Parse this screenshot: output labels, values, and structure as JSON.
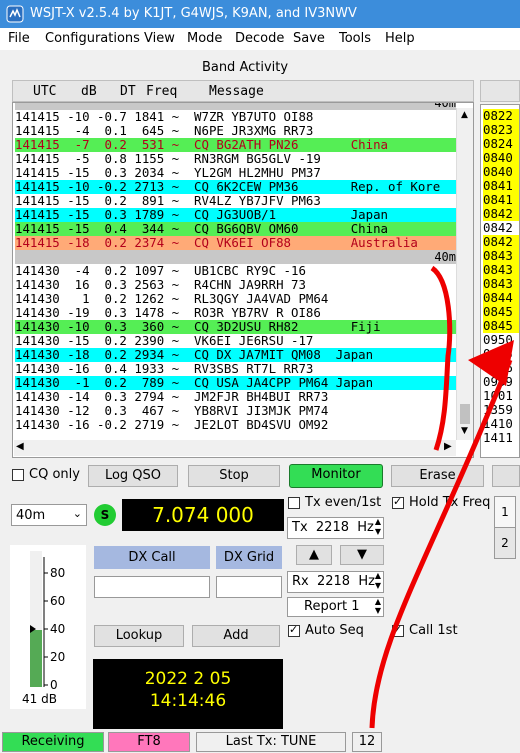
{
  "window": {
    "title": "WSJT-X   v2.5.4   by K1JT, G4WJS, K9AN, and IV3NWV"
  },
  "menu": [
    "File",
    "Configurations",
    "View",
    "Mode",
    "Decode",
    "Save",
    "Tools",
    "Help"
  ],
  "band_activity": {
    "title": "Band Activity",
    "columns": [
      "UTC",
      "dB",
      "DT",
      "Freq",
      "Message"
    ],
    "band_marker_top": "40m",
    "rows": [
      {
        "text": "141415 -10 -0.7 1841 ~  W7ZR YB7UTO OI88",
        "bg": "#ffffff",
        "fg": "#000000"
      },
      {
        "text": "141415  -4  0.1  645 ~  N6PE JR3XMG RR73",
        "bg": "#ffffff",
        "fg": "#000000"
      },
      {
        "text": "141415  -7  0.2  531 ~  CQ BG2ATH PN26       China",
        "bg": "#55ee55",
        "fg": "#b3001b"
      },
      {
        "text": "141415  -5  0.8 1155 ~  RN3RGM BG5GLV -19",
        "bg": "#ffffff",
        "fg": "#000000"
      },
      {
        "text": "141415 -15  0.3 2034 ~  YL2GM HL2MHU PM37",
        "bg": "#ffffff",
        "fg": "#000000"
      },
      {
        "text": "141415 -10 -0.2 2713 ~  CQ 6K2CEW PM36       Rep. of Kore",
        "bg": "#00ffff",
        "fg": "#000000"
      },
      {
        "text": "141415 -15  0.2  891 ~  RV4LZ YB7JFV PM63",
        "bg": "#ffffff",
        "fg": "#000000"
      },
      {
        "text": "141415 -15  0.3 1789 ~  CQ JG3UOB/1          Japan",
        "bg": "#00ffff",
        "fg": "#000000"
      },
      {
        "text": "141415 -15  0.4  344 ~  CQ BG6QBV OM60       China",
        "bg": "#55ee55",
        "fg": "#000000"
      },
      {
        "text": "141415 -18  0.2 2374 ~  CQ VK6EI OF88        Australia",
        "bg": "#ffaa77",
        "fg": "#b3001b"
      },
      {
        "sep": "40m"
      },
      {
        "text": "141430  -4  0.2 1097 ~  UB1CBC RY9C -16",
        "bg": "#ffffff",
        "fg": "#000000"
      },
      {
        "text": "141430  16  0.3 2563 ~  R4CHN JA9RRH 73",
        "bg": "#ffffff",
        "fg": "#000000"
      },
      {
        "text": "141430   1  0.2 1262 ~  RL3QGY JA4VAD PM64",
        "bg": "#ffffff",
        "fg": "#000000"
      },
      {
        "text": "141430 -19  0.3 1478 ~  RO3R YB7RV R OI86",
        "bg": "#ffffff",
        "fg": "#000000"
      },
      {
        "text": "141430 -10  0.3  360 ~  CQ 3D2USU RH82       Fiji",
        "bg": "#55ee55",
        "fg": "#000000"
      },
      {
        "text": "141430 -15  0.2 2390 ~  VK6EI JE6RSU -17",
        "bg": "#ffffff",
        "fg": "#000000"
      },
      {
        "text": "141430 -18  0.2 2934 ~  CQ DX JA7MIT QM08  Japan",
        "bg": "#00ffff",
        "fg": "#000000"
      },
      {
        "text": "141430 -16  0.4 1933 ~  RV3SBS RT7L RR73",
        "bg": "#ffffff",
        "fg": "#000000"
      },
      {
        "text": "141430  -1  0.2  789 ~  CQ USA JA4CPP PM64 Japan",
        "bg": "#00ffff",
        "fg": "#000000"
      },
      {
        "text": "141430 -14  0.3 2794 ~  JM2FJR BH4BUI RR73",
        "bg": "#ffffff",
        "fg": "#000000"
      },
      {
        "text": "141430 -12  0.3  467 ~  YB8RVI JI3MJK PM74",
        "bg": "#ffffff",
        "fg": "#000000"
      },
      {
        "text": "141430 -16 -0.2 2719 ~  JE2LOT BD4SVU OM92",
        "bg": "#ffffff",
        "fg": "#000000"
      }
    ]
  },
  "right_panel": {
    "rows": [
      {
        "text": "0822",
        "bg": "#ffff00"
      },
      {
        "text": "0823",
        "bg": "#ffff00"
      },
      {
        "text": "0824",
        "bg": "#ffff00"
      },
      {
        "text": "0840",
        "bg": "#ffff00"
      },
      {
        "text": "0840",
        "bg": "#ffff00"
      },
      {
        "text": "0841",
        "bg": "#ffff00"
      },
      {
        "text": "0841",
        "bg": "#ffff00"
      },
      {
        "text": "0842",
        "bg": "#ffff00"
      },
      {
        "text": "0842",
        "bg": "#ffffff"
      },
      {
        "text": "0842",
        "bg": "#ffff00"
      },
      {
        "text": "0843",
        "bg": "#ffff00"
      },
      {
        "text": "0843",
        "bg": "#ffff00"
      },
      {
        "text": "0843",
        "bg": "#ffff00"
      },
      {
        "text": "0844",
        "bg": "#ffff00"
      },
      {
        "text": "0845",
        "bg": "#ffff00"
      },
      {
        "text": "0845",
        "bg": "#ffff00"
      },
      {
        "text": "0950",
        "bg": "#ffffff"
      },
      {
        "text": "0955",
        "bg": "#ffffff"
      },
      {
        "text": "0956",
        "bg": "#ffffff"
      },
      {
        "text": "0959",
        "bg": "#ffffff"
      },
      {
        "text": "1001",
        "bg": "#ffffff"
      },
      {
        "text": "1359",
        "bg": "#ffffff"
      },
      {
        "text": "1410",
        "bg": "#ffffff"
      },
      {
        "text": "1411",
        "bg": "#ffffff"
      }
    ]
  },
  "controls": {
    "cq_only": "CQ only",
    "log_qso": "Log QSO",
    "stop": "Stop",
    "monitor": "Monitor",
    "erase": "Erase",
    "band": "40m",
    "s_badge": "S",
    "dial_freq": "7.074 000",
    "tx_even": "Tx even/1st",
    "hold_tx_freq": "Hold Tx Freq",
    "tx_freq": "Tx  2218  Hz",
    "rx_freq": "Rx  2218  Hz",
    "report": "Report 1",
    "auto_seq": "Auto Seq",
    "call_1st": "Call 1st",
    "dx_call": "DX Call",
    "dx_grid": "DX Grid",
    "lookup": "Lookup",
    "add": "Add",
    "clock_date": "2022 2 05",
    "clock_time": "14:14:46",
    "meter_labels": [
      "80",
      "60",
      "40",
      "20",
      "0"
    ],
    "meter_db": "41 dB",
    "meter_level": 0.41,
    "tabs": [
      "1",
      "2"
    ]
  },
  "status": {
    "receiving": "Receiving",
    "mode": "FT8",
    "last_tx": "Last Tx: TUNE",
    "count": "12"
  },
  "colors": {
    "accent_green": "#55ee55",
    "monitor_green": "#33dd55",
    "ft8_pink": "#ff77bb",
    "annotation_red": "#ee0000"
  }
}
